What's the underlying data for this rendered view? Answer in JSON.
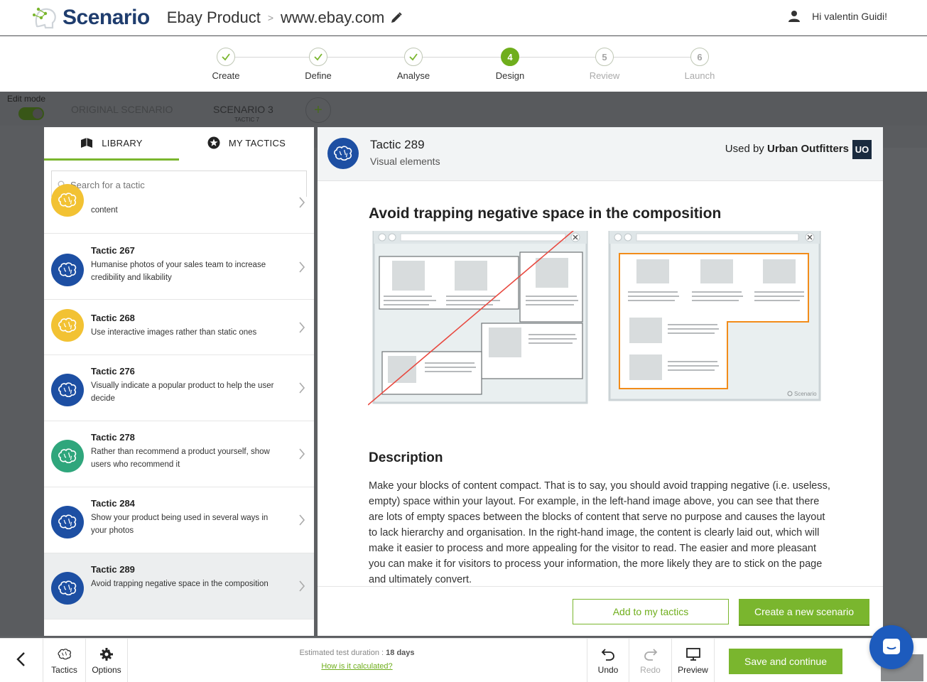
{
  "header": {
    "logo_text": "Scenario",
    "project": "Ebay Product",
    "separator": ">",
    "site": "www.ebay.com",
    "user_greeting": "Hi valentin Guidi!"
  },
  "stepper": {
    "steps": [
      {
        "label": "Create",
        "state": "done"
      },
      {
        "label": "Define",
        "state": "done"
      },
      {
        "label": "Analyse",
        "state": "done"
      },
      {
        "label": "Design",
        "state": "active",
        "number": "4"
      },
      {
        "label": "Review",
        "state": "pending",
        "number": "5"
      },
      {
        "label": "Launch",
        "state": "pending",
        "number": "6"
      }
    ]
  },
  "scenario_bar": {
    "edit_mode": "Edit mode",
    "original": "ORIGINAL SCENARIO",
    "current": "SCENARIO 3",
    "current_sub": "TACTIC 7",
    "add": "+"
  },
  "library": {
    "tab_library": "LIBRARY",
    "tab_my_tactics": "MY TACTICS",
    "search_placeholder": "Search for a tactic",
    "partial_item_desc": "content",
    "items": [
      {
        "title": "Tactic 267",
        "desc": "Humanise photos of your sales team to increase credibility and likability",
        "color": "#1d4fa3"
      },
      {
        "title": "Tactic 268",
        "desc": "Use interactive images rather than static ones",
        "color": "#f2c233"
      },
      {
        "title": "Tactic 276",
        "desc": "Visually indicate a popular product to help the user decide",
        "color": "#1d4fa3"
      },
      {
        "title": "Tactic 278",
        "desc": "Rather than recommend a product yourself, show users who recommend it",
        "color": "#2fa67c"
      },
      {
        "title": "Tactic 284",
        "desc": "Show your product being used in several ways in your photos",
        "color": "#1d4fa3"
      },
      {
        "title": "Tactic 289",
        "desc": "Avoid trapping negative space in the composition",
        "color": "#1d4fa3",
        "selected": true
      }
    ]
  },
  "detail": {
    "title": "Tactic 289",
    "subtitle": "Visual elements",
    "used_by_prefix": "Used by",
    "used_by_company": "Urban Outfitters",
    "company_badge": "UO",
    "heading": "Avoid trapping negative space in the composition",
    "illustration_brand": "Scenario",
    "description_heading": "Description",
    "description": "Make your blocks of content compact. That is to say, you should avoid trapping negative (i.e. useless, empty) space within your layout. For example, in the left-hand image above, you can see that there are lots of empty spaces between the blocks of content that serve no purpose and causes the layout to lack hierarchy and organisation. In the right-hand image, the content is clearly laid out, which will make it easier to process and more appealing for the visitor to read. The easier and more pleasant you can make it for visitors to process your information, the more likely they are to stick on the page and ultimately convert.",
    "add_button": "Add to my tactics",
    "create_button": "Create a new scenario"
  },
  "bottom": {
    "tactics": "Tactics",
    "options": "Options",
    "estimate_prefix": "Estimated test duration :",
    "estimate_value": "18 days",
    "estimate_link": "How is it calculated?",
    "undo": "Undo",
    "redo": "Redo",
    "preview": "Preview",
    "save": "Save and continue"
  },
  "colors": {
    "brand_green": "#7ab62e",
    "brand_blue": "#1d4fa3",
    "logo_navy": "#1f3d6e"
  }
}
